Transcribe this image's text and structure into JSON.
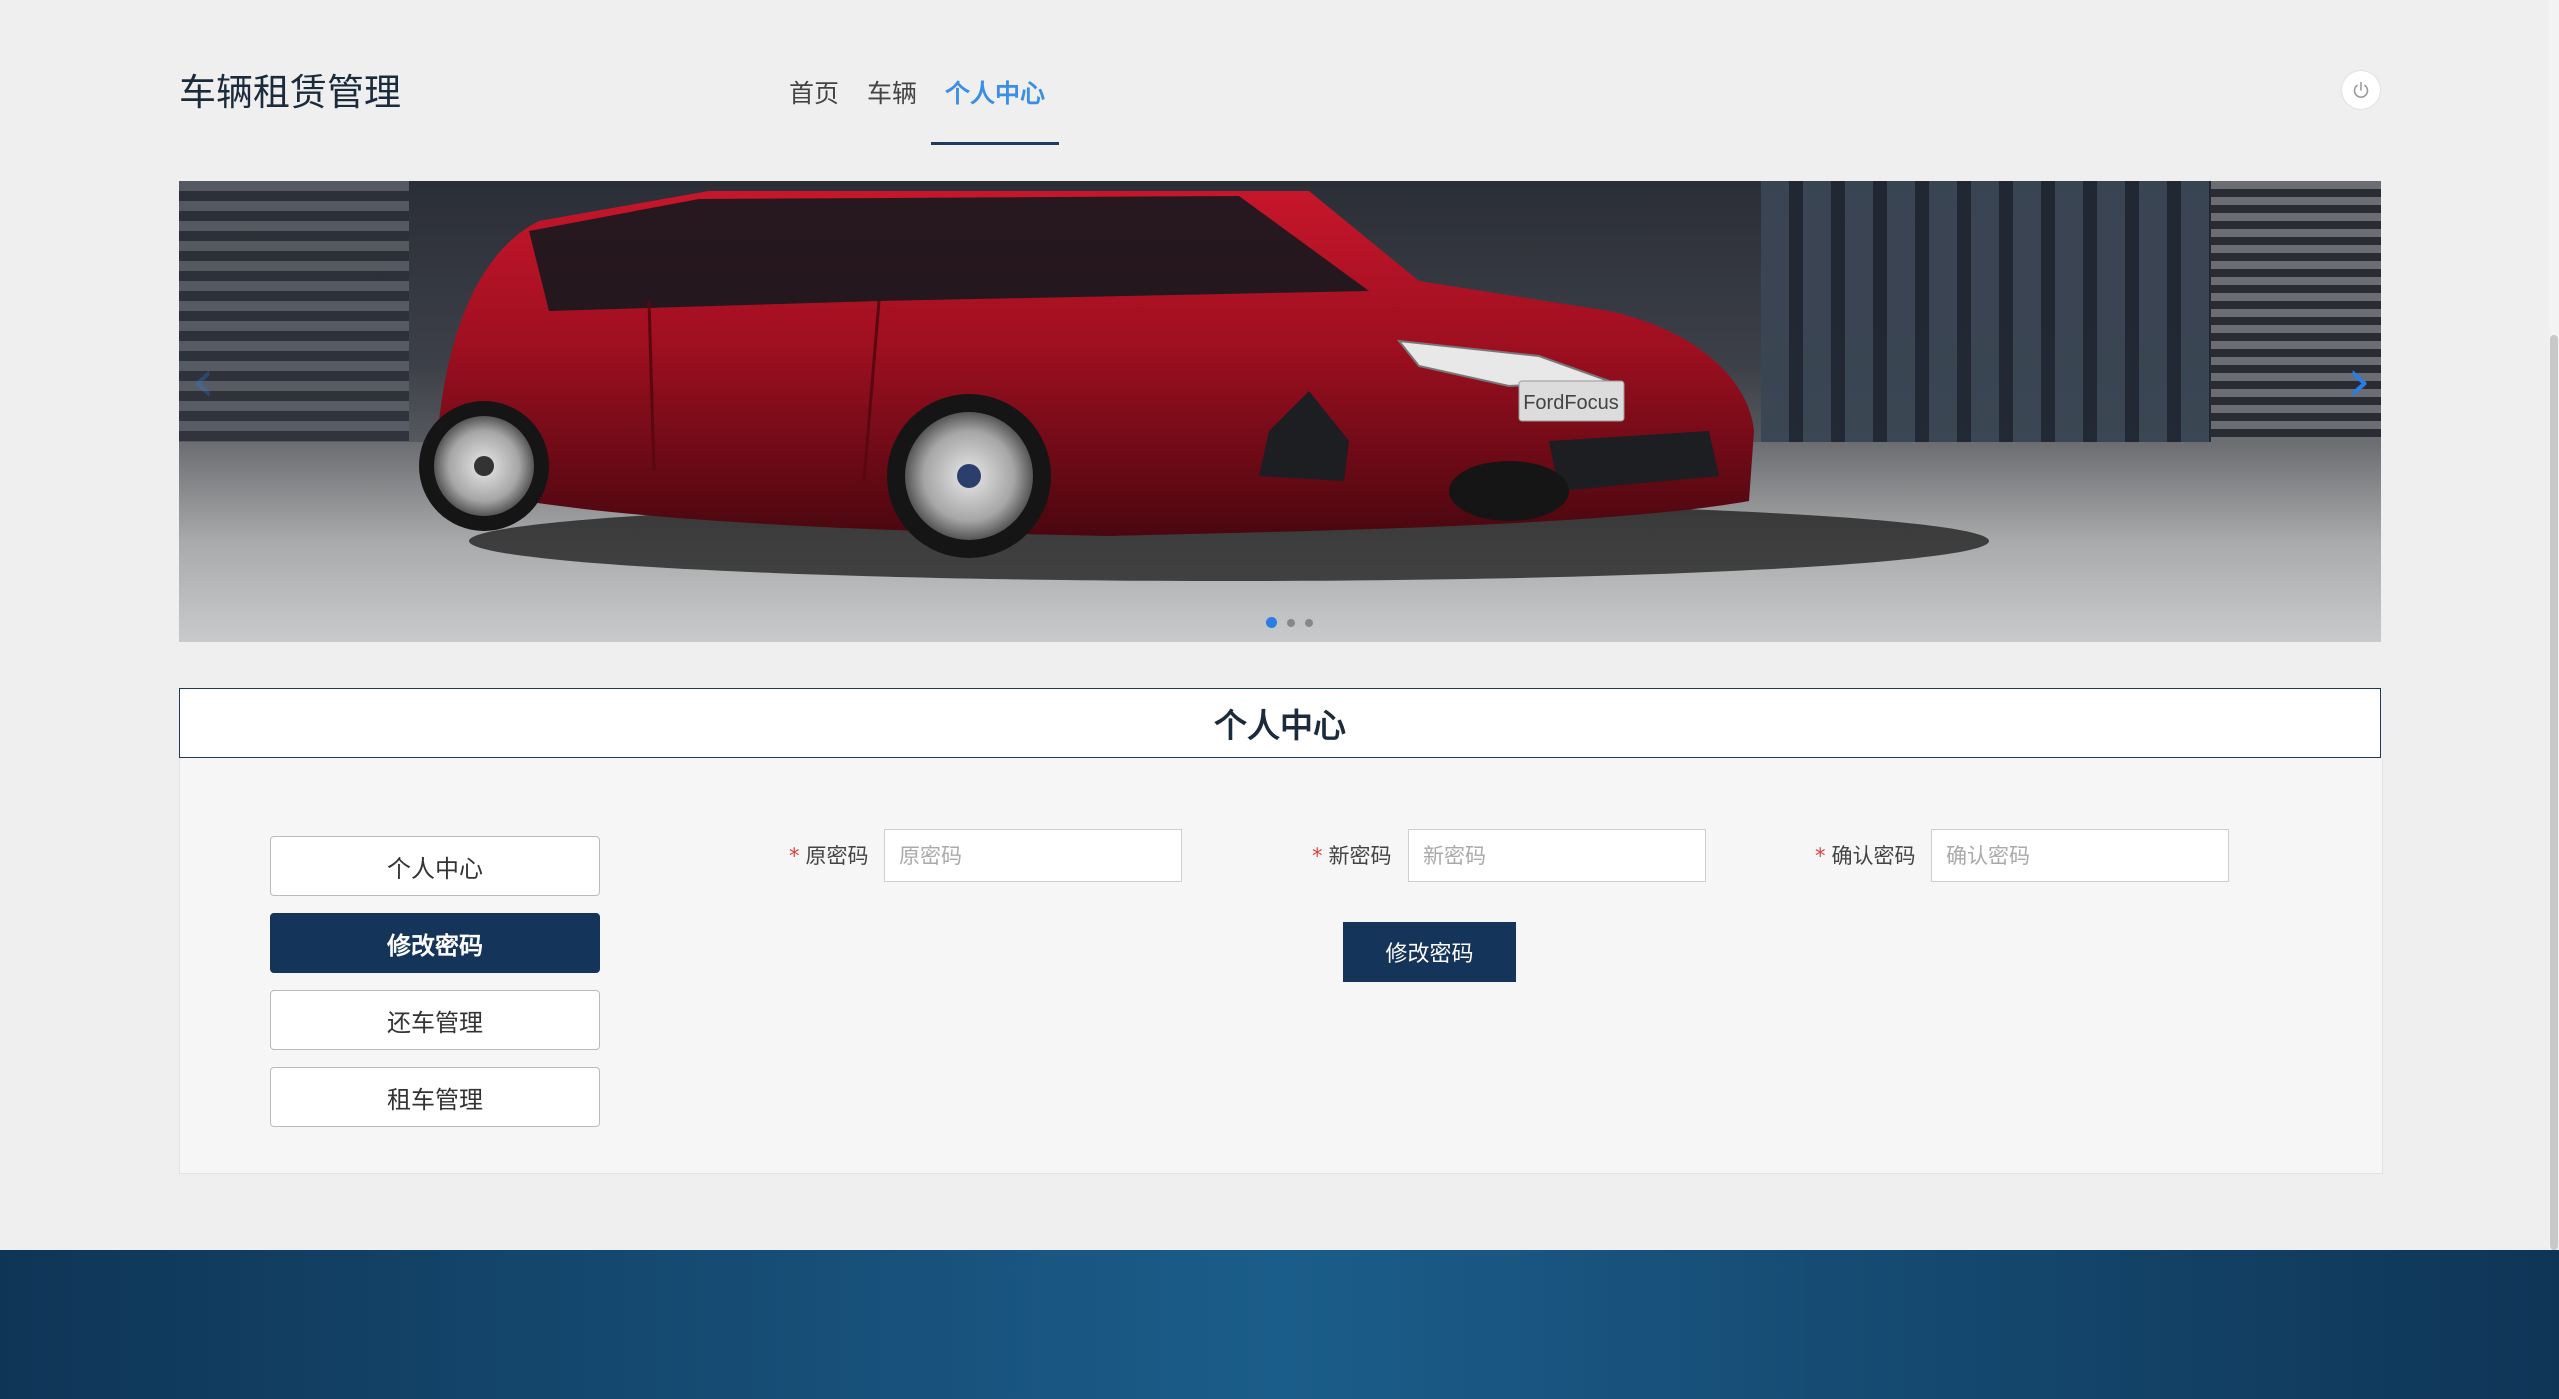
{
  "header": {
    "brand": "车辆租赁管理",
    "nav": [
      {
        "label": "首页"
      },
      {
        "label": "车辆"
      },
      {
        "label": "个人中心",
        "active": true
      }
    ],
    "logout_icon": "power-icon"
  },
  "banner": {
    "car_plate_text": "FordFocus",
    "slide_count": 3,
    "active_slide": 1,
    "prev_icon": "chevron-left-icon",
    "next_icon": "chevron-right-icon"
  },
  "panel": {
    "title": "个人中心",
    "side_menu": [
      {
        "label": "个人中心",
        "active": false
      },
      {
        "label": "修改密码",
        "active": true
      },
      {
        "label": "还车管理",
        "active": false
      },
      {
        "label": "租车管理",
        "active": false
      }
    ],
    "form": {
      "old_password": {
        "label": "原密码",
        "placeholder": "原密码",
        "required": "*"
      },
      "new_password": {
        "label": "新密码",
        "placeholder": "新密码",
        "required": "*"
      },
      "confirm_password": {
        "label": "确认密码",
        "placeholder": "确认密码",
        "required": "*"
      },
      "submit_label": "修改密码"
    }
  },
  "colors": {
    "primary": "#153459",
    "accent": "#3a8ee6",
    "footer": "#1b5d8a"
  }
}
